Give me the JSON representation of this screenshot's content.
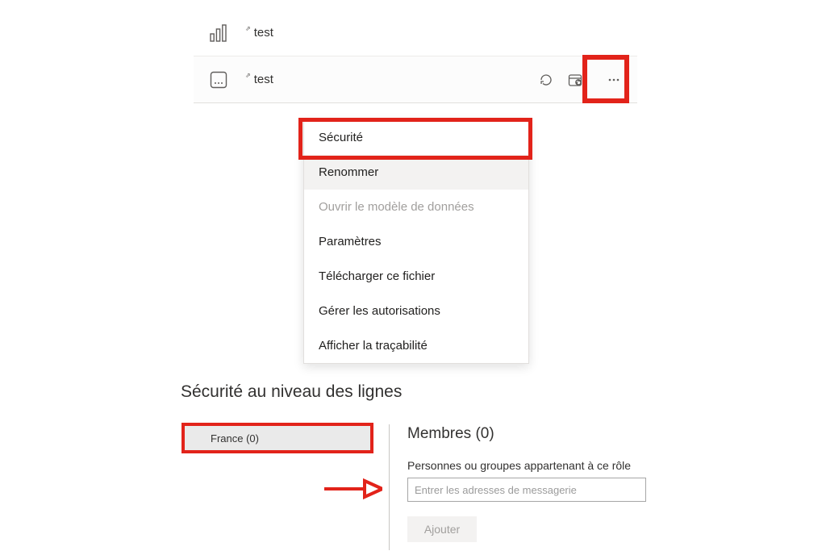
{
  "rows": [
    {
      "name": "test"
    },
    {
      "name": "test"
    }
  ],
  "menu": {
    "security": "Sécurité",
    "rename": "Renommer",
    "open_model": "Ouvrir le modèle de données",
    "settings": "Paramètres",
    "download": "Télécharger ce fichier",
    "manage_permissions": "Gérer les autorisations",
    "lineage": "Afficher la traçabilité"
  },
  "rls": {
    "title": "Sécurité au niveau des lignes",
    "role_label": "France (0)",
    "members_title": "Membres (0)",
    "members_sub": "Personnes ou groupes appartenant à ce rôle",
    "input_placeholder": "Entrer les adresses de messagerie",
    "add_button": "Ajouter"
  }
}
